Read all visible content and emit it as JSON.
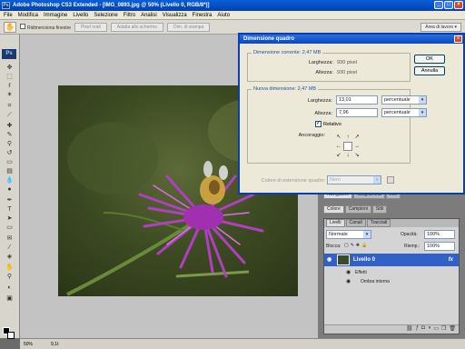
{
  "window": {
    "title": "Adobe Photoshop CS3 Extended - [IMG_0893.jpg @ 50% (Livello 0, RGB/8*)]",
    "logo": "Ps",
    "buttons": [
      "_",
      "□",
      "×"
    ]
  },
  "menu": [
    "File",
    "Modifica",
    "Immagine",
    "Livello",
    "Selezione",
    "Filtro",
    "Analisi",
    "Visualizza",
    "Finestra",
    "Aiuto"
  ],
  "options": {
    "checkbox_label": "Ridimensiona finestre",
    "btn1": "Pixel reali",
    "btn2": "Adatta allo schermo",
    "btn3": "Dim. di stampa",
    "workspace": "Area di lavoro ▾"
  },
  "toolbox": {
    "logo": "Ps"
  },
  "status": {
    "zoom": "50%",
    "doc": "9,1t"
  },
  "panels": {
    "tabs_top": [
      "Navigatore",
      "Istogramma",
      "Info"
    ],
    "tabs_mid": [
      "Colore",
      "Campioni",
      "Stili"
    ],
    "tabs_layers": [
      "Livelli",
      "Canali",
      "Tracciati"
    ],
    "blend_mode": "Normale",
    "opacity_label": "Opacità:",
    "opacity_value": "100%",
    "lock_label": "Blocca:",
    "fill_label": "Riemp.:",
    "fill_value": "100%",
    "layer_name": "Livello 0",
    "fx": "fx",
    "effects_label": "Effetti",
    "effect_item": "Ombra interna"
  },
  "dialog": {
    "title": "Dimensione quadro",
    "close": "×",
    "current_label": "Dimensione corrente: 2,47 MB",
    "width_label": "Larghezza:",
    "width_value": "930 pixel",
    "height_label": "Altezza:",
    "height_value": "930 pixel",
    "new_label": "Nuova dimensione: 2,47 MB",
    "new_width_label": "Larghezza:",
    "new_width": "13,01",
    "new_height_label": "Altezza:",
    "new_height": "7,96",
    "unit": "percentuale",
    "relative_label": "Relativo",
    "anchor_label": "Ancoraggio:",
    "ext_color_label": "Colore di estensione quadro:",
    "ext_color_value": "Nero",
    "ok": "OK",
    "cancel": "Annulla"
  },
  "colors": {
    "accent": "#0a48c0",
    "selected_layer": "#3060c8"
  }
}
